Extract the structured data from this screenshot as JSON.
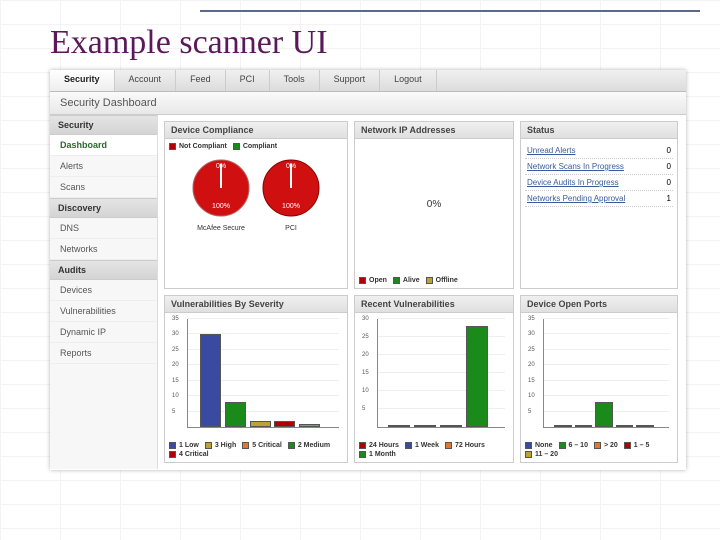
{
  "slide_title": "Example scanner UI",
  "nav": [
    "Security",
    "Account",
    "Feed",
    "PCI",
    "Tools",
    "Support",
    "Logout"
  ],
  "breadcrumb": "Security Dashboard",
  "sidebar": {
    "groups": [
      {
        "title": "Security",
        "items": [
          "Dashboard",
          "Alerts",
          "Scans"
        ]
      },
      {
        "title": "Discovery",
        "items": [
          "DNS",
          "Networks"
        ]
      },
      {
        "title": "Audits",
        "items": [
          "Devices",
          "Vulnerabilities",
          "Dynamic IP",
          "Reports"
        ]
      }
    ],
    "selected": "Dashboard"
  },
  "panels": {
    "device_compliance": {
      "title": "Device Compliance",
      "legend": [
        [
          "#b00000",
          "Not Compliant"
        ],
        [
          "#1a8a1a",
          "Compliant"
        ]
      ],
      "gauges": [
        [
          "0%",
          "100%",
          "McAfee Secure"
        ],
        [
          "0%",
          "100%",
          "PCI"
        ]
      ]
    },
    "network_ip": {
      "title": "Network IP Addresses",
      "value": "0%",
      "legend": [
        [
          "#b00000",
          "Open"
        ],
        [
          "#1a8a1a",
          "Alive"
        ],
        [
          "#c0a030",
          "Offline"
        ]
      ]
    },
    "status": {
      "title": "Status",
      "rows": [
        [
          "Unread Alerts",
          "0"
        ],
        [
          "Network Scans In Progress",
          "0"
        ],
        [
          "Device Audits In Progress",
          "0"
        ],
        [
          "Networks Pending Approval",
          "1"
        ]
      ]
    },
    "vuln_severity": {
      "title": "Vulnerabilities By Severity",
      "legend": [
        [
          "#3a4aa0",
          "1 Low"
        ],
        [
          "#1a8a1a",
          "2 Medium"
        ],
        [
          "#c0a030",
          "3 High"
        ],
        [
          "#b00000",
          "4 Critical"
        ],
        [
          "#e07830",
          "5 Critical"
        ]
      ]
    },
    "recent_vuln": {
      "title": "Recent Vulnerabilities",
      "legend": [
        [
          "#b00000",
          "24 Hours"
        ],
        [
          "#e07830",
          "72 Hours"
        ],
        [
          "#3a4aa0",
          "1 Week"
        ],
        [
          "#1a8a1a",
          "1 Month"
        ]
      ]
    },
    "open_ports": {
      "title": "Device Open Ports",
      "legend": [
        [
          "#3a4aa0",
          "None"
        ],
        [
          "#b00000",
          "1 – 5"
        ],
        [
          "#1a8a1a",
          "6 – 10"
        ],
        [
          "#c0a030",
          "11 – 20"
        ],
        [
          "#e07830",
          "> 20"
        ]
      ]
    }
  },
  "chart_data": [
    {
      "type": "bar",
      "title": "Vulnerabilities By Severity",
      "categories": [
        "1 Low",
        "2 Medium",
        "3 High",
        "4 Critical",
        "5 Critical"
      ],
      "values": [
        30,
        8,
        2,
        2,
        1
      ],
      "colors": [
        "#3a4aa0",
        "#1a8a1a",
        "#c0a030",
        "#b00000",
        "#e07830"
      ],
      "ylim": [
        0,
        35
      ],
      "yticks": [
        5,
        10,
        15,
        20,
        25,
        30,
        35
      ]
    },
    {
      "type": "bar",
      "title": "Recent Vulnerabilities",
      "categories": [
        "24 Hours",
        "72 Hours",
        "1 Week",
        "1 Month"
      ],
      "values": [
        0,
        0,
        0,
        28
      ],
      "colors": [
        "#b00000",
        "#e07830",
        "#3a4aa0",
        "#1a8a1a"
      ],
      "ylim": [
        0,
        30
      ],
      "yticks": [
        5,
        10,
        15,
        20,
        25,
        30
      ]
    },
    {
      "type": "bar",
      "title": "Device Open Ports",
      "categories": [
        "None",
        "1 – 5",
        "6 – 10",
        "11 – 20",
        "> 20"
      ],
      "values": [
        0,
        0,
        8,
        0,
        0
      ],
      "colors": [
        "#3a4aa0",
        "#b00000",
        "#1a8a1a",
        "#c0a030",
        "#e07830"
      ],
      "ylim": [
        0,
        35
      ],
      "yticks": [
        5,
        10,
        15,
        20,
        25,
        30,
        35
      ]
    },
    {
      "type": "pie",
      "title": "Device Compliance",
      "series": [
        {
          "name": "McAfee Secure",
          "slices": [
            [
              "Compliant",
              0
            ],
            [
              "Not Compliant",
              100
            ]
          ]
        },
        {
          "name": "PCI",
          "slices": [
            [
              "Compliant",
              0
            ],
            [
              "Not Compliant",
              100
            ]
          ]
        }
      ]
    }
  ]
}
